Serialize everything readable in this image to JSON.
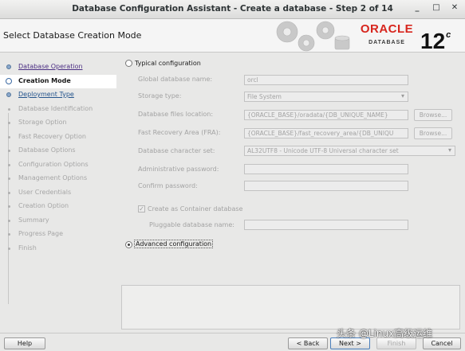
{
  "window": {
    "title": "Database Configuration Assistant - Create a database - Step 2 of 14",
    "controls": {
      "minimize": "_",
      "maximize": "□",
      "close": "✕"
    }
  },
  "header": {
    "heading": "Select Database Creation Mode",
    "brand": "ORACLE",
    "brand_sub": "DATABASE",
    "version": "12",
    "version_suffix": "c"
  },
  "steps": [
    {
      "label": "Database Operation",
      "state": "visited"
    },
    {
      "label": "Creation Mode",
      "state": "current"
    },
    {
      "label": "Deployment Type",
      "state": "next"
    },
    {
      "label": "Database Identification",
      "state": "disabled"
    },
    {
      "label": "Storage Option",
      "state": "disabled"
    },
    {
      "label": "Fast Recovery Option",
      "state": "disabled"
    },
    {
      "label": "Database Options",
      "state": "disabled"
    },
    {
      "label": "Configuration Options",
      "state": "disabled"
    },
    {
      "label": "Management Options",
      "state": "disabled"
    },
    {
      "label": "User Credentials",
      "state": "disabled"
    },
    {
      "label": "Creation Option",
      "state": "disabled"
    },
    {
      "label": "Summary",
      "state": "disabled"
    },
    {
      "label": "Progress Page",
      "state": "disabled"
    },
    {
      "label": "Finish",
      "state": "disabled"
    }
  ],
  "form": {
    "typical": {
      "label": "Typical configuration",
      "selected": false
    },
    "global_db_name": {
      "label": "Global database name:",
      "value": "orcl"
    },
    "storage_type": {
      "label": "Storage type:",
      "value": "File System"
    },
    "db_files_location": {
      "label": "Database files location:",
      "value": "{ORACLE_BASE}/oradata/{DB_UNIQUE_NAME}",
      "browse": "Browse..."
    },
    "fast_recovery_area": {
      "label": "Fast Recovery Area (FRA):",
      "value": "{ORACLE_BASE}/fast_recovery_area/{DB_UNIQU",
      "browse": "Browse..."
    },
    "charset": {
      "label": "Database character set:",
      "value": "AL32UTF8 - Unicode UTF-8 Universal character set"
    },
    "admin_password": {
      "label": "Administrative password:",
      "value": ""
    },
    "confirm_password": {
      "label": "Confirm password:",
      "value": ""
    },
    "container_db": {
      "label": "Create as Container database",
      "checked": true,
      "check_glyph": "✓"
    },
    "pluggable_db_name": {
      "label": "Pluggable database name:",
      "value": ""
    },
    "advanced": {
      "label": "Advanced configuration",
      "selected": true
    }
  },
  "buttons": {
    "help": "Help",
    "back": "< Back",
    "next": "Next >",
    "finish": "Finish",
    "cancel": "Cancel"
  },
  "watermark": "头条 @Linux高级运维",
  "colors": {
    "oracle_red": "#d7261e",
    "link": "#24548c",
    "visited": "#4b2e83"
  }
}
